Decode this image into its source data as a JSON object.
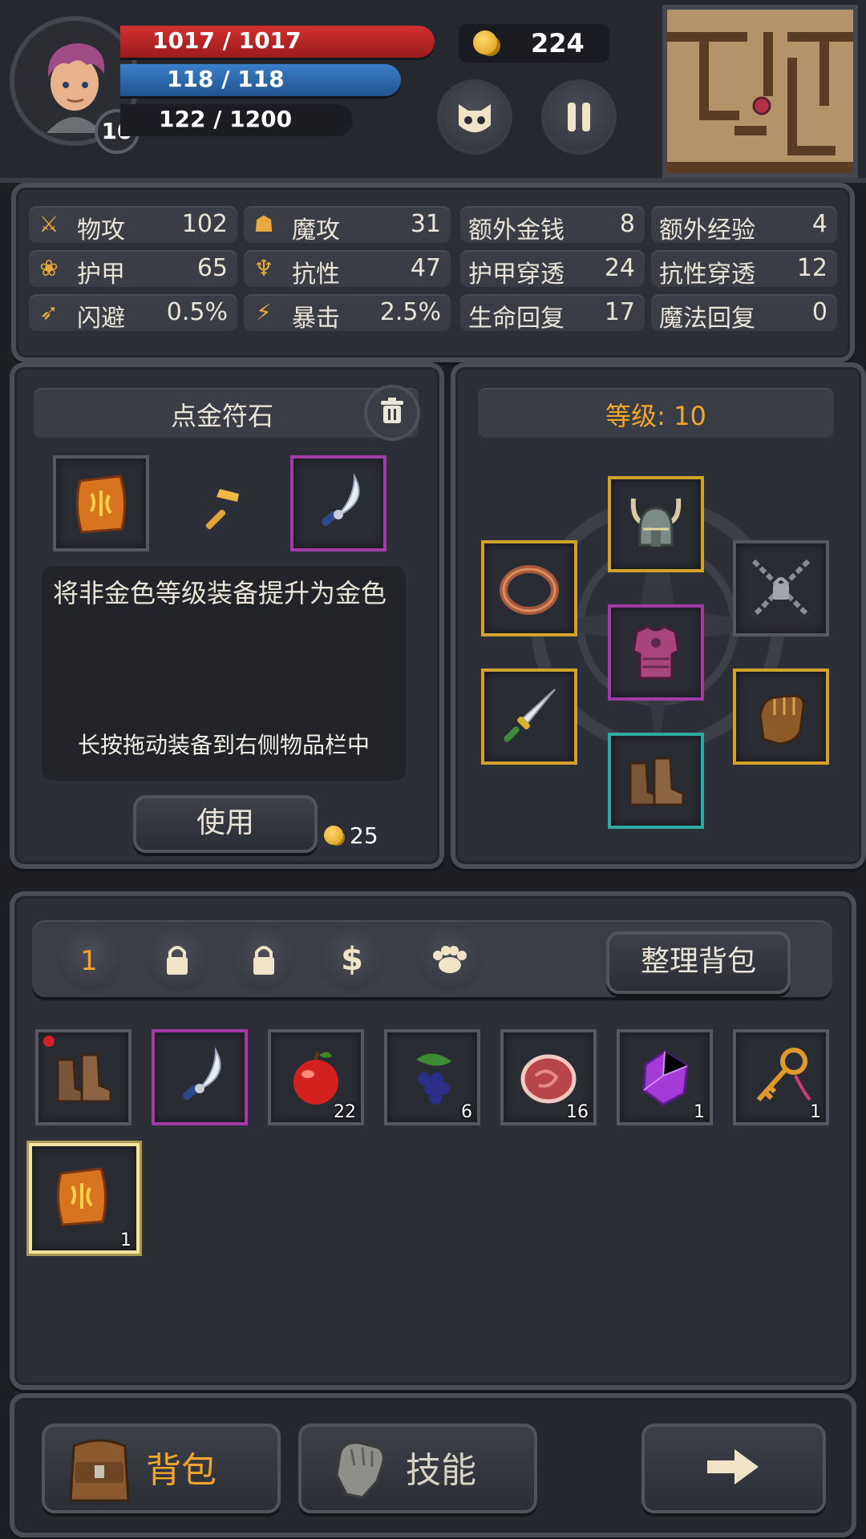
{
  "hud": {
    "hp": "1017 / 1017",
    "mp": "118 / 118",
    "xp": "122 / 1200",
    "level": "10",
    "gold": "224",
    "colors": {
      "hp": "#c0262a",
      "mp": "#2f6db5",
      "gold": "#f0b42a"
    }
  },
  "stats": [
    {
      "icon": "sword-icon",
      "name": "物攻",
      "value": "102"
    },
    {
      "icon": "magic-hat-icon",
      "name": "魔攻",
      "value": "31"
    },
    {
      "icon": "",
      "name": "额外金钱",
      "value": "8"
    },
    {
      "icon": "",
      "name": "额外经验",
      "value": "4"
    },
    {
      "icon": "armor-paw-icon",
      "name": "护甲",
      "value": "65"
    },
    {
      "icon": "resistance-icon",
      "name": "抗性",
      "value": "47"
    },
    {
      "icon": "",
      "name": "护甲穿透",
      "value": "24"
    },
    {
      "icon": "",
      "name": "抗性穿透",
      "value": "12"
    },
    {
      "icon": "run-icon",
      "name": "闪避",
      "value": "0.5%"
    },
    {
      "icon": "lightning-icon",
      "name": "暴击",
      "value": "2.5%"
    },
    {
      "icon": "",
      "name": "生命回复",
      "value": "17"
    },
    {
      "icon": "",
      "name": "魔法回复",
      "value": "0"
    }
  ],
  "forge": {
    "title": "点金符石",
    "description": "将非金色等级装备提升为金色",
    "hint": "长按拖动装备到右侧物品栏中",
    "use_label": "使用",
    "cost": "25"
  },
  "equipment": {
    "level_label": "等级: 10"
  },
  "inventory": {
    "page_label": "1",
    "sort_label": "整理背包",
    "items": [
      {
        "icon": "boots-icon",
        "count": "",
        "border": "grey"
      },
      {
        "icon": "scimitar-icon",
        "count": "",
        "border": "purple"
      },
      {
        "icon": "apple-icon",
        "count": "22",
        "border": "grey"
      },
      {
        "icon": "grapes-icon",
        "count": "6",
        "border": "grey"
      },
      {
        "icon": "meat-icon",
        "count": "16",
        "border": "grey"
      },
      {
        "icon": "purple-gem-icon",
        "count": "1",
        "border": "grey"
      },
      {
        "icon": "key-icon",
        "count": "1",
        "border": "grey"
      },
      {
        "icon": "rune-stone-icon",
        "count": "1",
        "border": "selected"
      }
    ]
  },
  "nav": {
    "bag_label": "背包",
    "skills_label": "技能"
  }
}
